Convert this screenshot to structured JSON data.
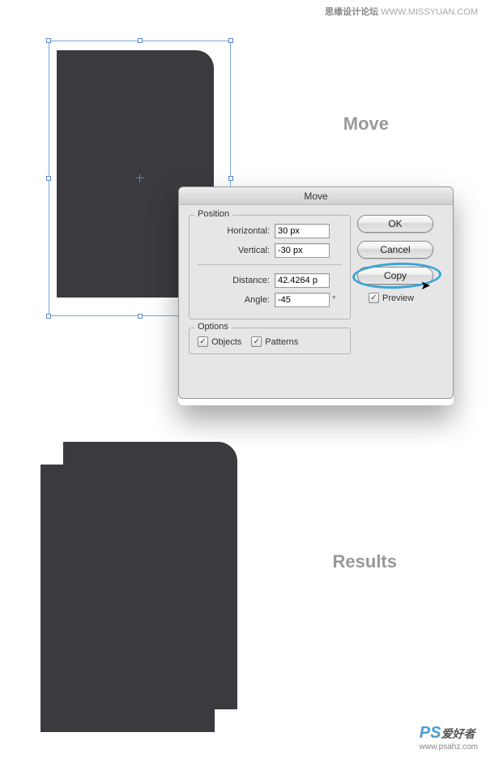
{
  "watermark": {
    "top_chinese": "思缘设计论坛",
    "top_url": "WWW.MISSYUAN.COM",
    "bottom_logo": "PS",
    "bottom_chinese": "爱好者",
    "bottom_url": "www.psahz.com"
  },
  "labels": {
    "move": "Move",
    "results": "Results"
  },
  "dialog": {
    "title": "Move",
    "position_legend": "Position",
    "horizontal_label": "Horizontal:",
    "horizontal_value": "30 px",
    "vertical_label": "Vertical:",
    "vertical_value": "-30 px",
    "distance_label": "Distance:",
    "distance_value": "42.4264 p",
    "angle_label": "Angle:",
    "angle_value": "-45",
    "angle_unit": "°",
    "options_legend": "Options",
    "objects_label": "Objects",
    "patterns_label": "Patterns",
    "ok_label": "OK",
    "cancel_label": "Cancel",
    "copy_label": "Copy",
    "preview_label": "Preview"
  }
}
